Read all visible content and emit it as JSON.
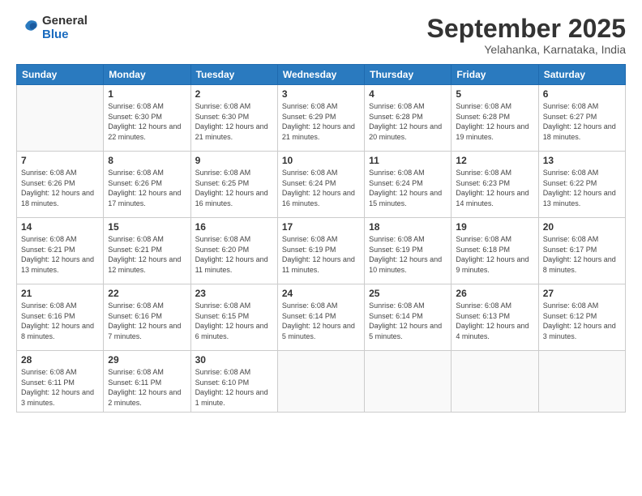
{
  "logo": {
    "general": "General",
    "blue": "Blue"
  },
  "title": "September 2025",
  "subtitle": "Yelahanka, Karnataka, India",
  "days_header": [
    "Sunday",
    "Monday",
    "Tuesday",
    "Wednesday",
    "Thursday",
    "Friday",
    "Saturday"
  ],
  "weeks": [
    [
      {
        "day": "",
        "info": ""
      },
      {
        "day": "1",
        "info": "Sunrise: 6:08 AM\nSunset: 6:30 PM\nDaylight: 12 hours\nand 22 minutes."
      },
      {
        "day": "2",
        "info": "Sunrise: 6:08 AM\nSunset: 6:30 PM\nDaylight: 12 hours\nand 21 minutes."
      },
      {
        "day": "3",
        "info": "Sunrise: 6:08 AM\nSunset: 6:29 PM\nDaylight: 12 hours\nand 21 minutes."
      },
      {
        "day": "4",
        "info": "Sunrise: 6:08 AM\nSunset: 6:28 PM\nDaylight: 12 hours\nand 20 minutes."
      },
      {
        "day": "5",
        "info": "Sunrise: 6:08 AM\nSunset: 6:28 PM\nDaylight: 12 hours\nand 19 minutes."
      },
      {
        "day": "6",
        "info": "Sunrise: 6:08 AM\nSunset: 6:27 PM\nDaylight: 12 hours\nand 18 minutes."
      }
    ],
    [
      {
        "day": "7",
        "info": "Sunrise: 6:08 AM\nSunset: 6:26 PM\nDaylight: 12 hours\nand 18 minutes."
      },
      {
        "day": "8",
        "info": "Sunrise: 6:08 AM\nSunset: 6:26 PM\nDaylight: 12 hours\nand 17 minutes."
      },
      {
        "day": "9",
        "info": "Sunrise: 6:08 AM\nSunset: 6:25 PM\nDaylight: 12 hours\nand 16 minutes."
      },
      {
        "day": "10",
        "info": "Sunrise: 6:08 AM\nSunset: 6:24 PM\nDaylight: 12 hours\nand 16 minutes."
      },
      {
        "day": "11",
        "info": "Sunrise: 6:08 AM\nSunset: 6:24 PM\nDaylight: 12 hours\nand 15 minutes."
      },
      {
        "day": "12",
        "info": "Sunrise: 6:08 AM\nSunset: 6:23 PM\nDaylight: 12 hours\nand 14 minutes."
      },
      {
        "day": "13",
        "info": "Sunrise: 6:08 AM\nSunset: 6:22 PM\nDaylight: 12 hours\nand 13 minutes."
      }
    ],
    [
      {
        "day": "14",
        "info": "Sunrise: 6:08 AM\nSunset: 6:21 PM\nDaylight: 12 hours\nand 13 minutes."
      },
      {
        "day": "15",
        "info": "Sunrise: 6:08 AM\nSunset: 6:21 PM\nDaylight: 12 hours\nand 12 minutes."
      },
      {
        "day": "16",
        "info": "Sunrise: 6:08 AM\nSunset: 6:20 PM\nDaylight: 12 hours\nand 11 minutes."
      },
      {
        "day": "17",
        "info": "Sunrise: 6:08 AM\nSunset: 6:19 PM\nDaylight: 12 hours\nand 11 minutes."
      },
      {
        "day": "18",
        "info": "Sunrise: 6:08 AM\nSunset: 6:19 PM\nDaylight: 12 hours\nand 10 minutes."
      },
      {
        "day": "19",
        "info": "Sunrise: 6:08 AM\nSunset: 6:18 PM\nDaylight: 12 hours\nand 9 minutes."
      },
      {
        "day": "20",
        "info": "Sunrise: 6:08 AM\nSunset: 6:17 PM\nDaylight: 12 hours\nand 8 minutes."
      }
    ],
    [
      {
        "day": "21",
        "info": "Sunrise: 6:08 AM\nSunset: 6:16 PM\nDaylight: 12 hours\nand 8 minutes."
      },
      {
        "day": "22",
        "info": "Sunrise: 6:08 AM\nSunset: 6:16 PM\nDaylight: 12 hours\nand 7 minutes."
      },
      {
        "day": "23",
        "info": "Sunrise: 6:08 AM\nSunset: 6:15 PM\nDaylight: 12 hours\nand 6 minutes."
      },
      {
        "day": "24",
        "info": "Sunrise: 6:08 AM\nSunset: 6:14 PM\nDaylight: 12 hours\nand 5 minutes."
      },
      {
        "day": "25",
        "info": "Sunrise: 6:08 AM\nSunset: 6:14 PM\nDaylight: 12 hours\nand 5 minutes."
      },
      {
        "day": "26",
        "info": "Sunrise: 6:08 AM\nSunset: 6:13 PM\nDaylight: 12 hours\nand 4 minutes."
      },
      {
        "day": "27",
        "info": "Sunrise: 6:08 AM\nSunset: 6:12 PM\nDaylight: 12 hours\nand 3 minutes."
      }
    ],
    [
      {
        "day": "28",
        "info": "Sunrise: 6:08 AM\nSunset: 6:11 PM\nDaylight: 12 hours\nand 3 minutes."
      },
      {
        "day": "29",
        "info": "Sunrise: 6:08 AM\nSunset: 6:11 PM\nDaylight: 12 hours\nand 2 minutes."
      },
      {
        "day": "30",
        "info": "Sunrise: 6:08 AM\nSunset: 6:10 PM\nDaylight: 12 hours\nand 1 minute."
      },
      {
        "day": "",
        "info": ""
      },
      {
        "day": "",
        "info": ""
      },
      {
        "day": "",
        "info": ""
      },
      {
        "day": "",
        "info": ""
      }
    ]
  ]
}
